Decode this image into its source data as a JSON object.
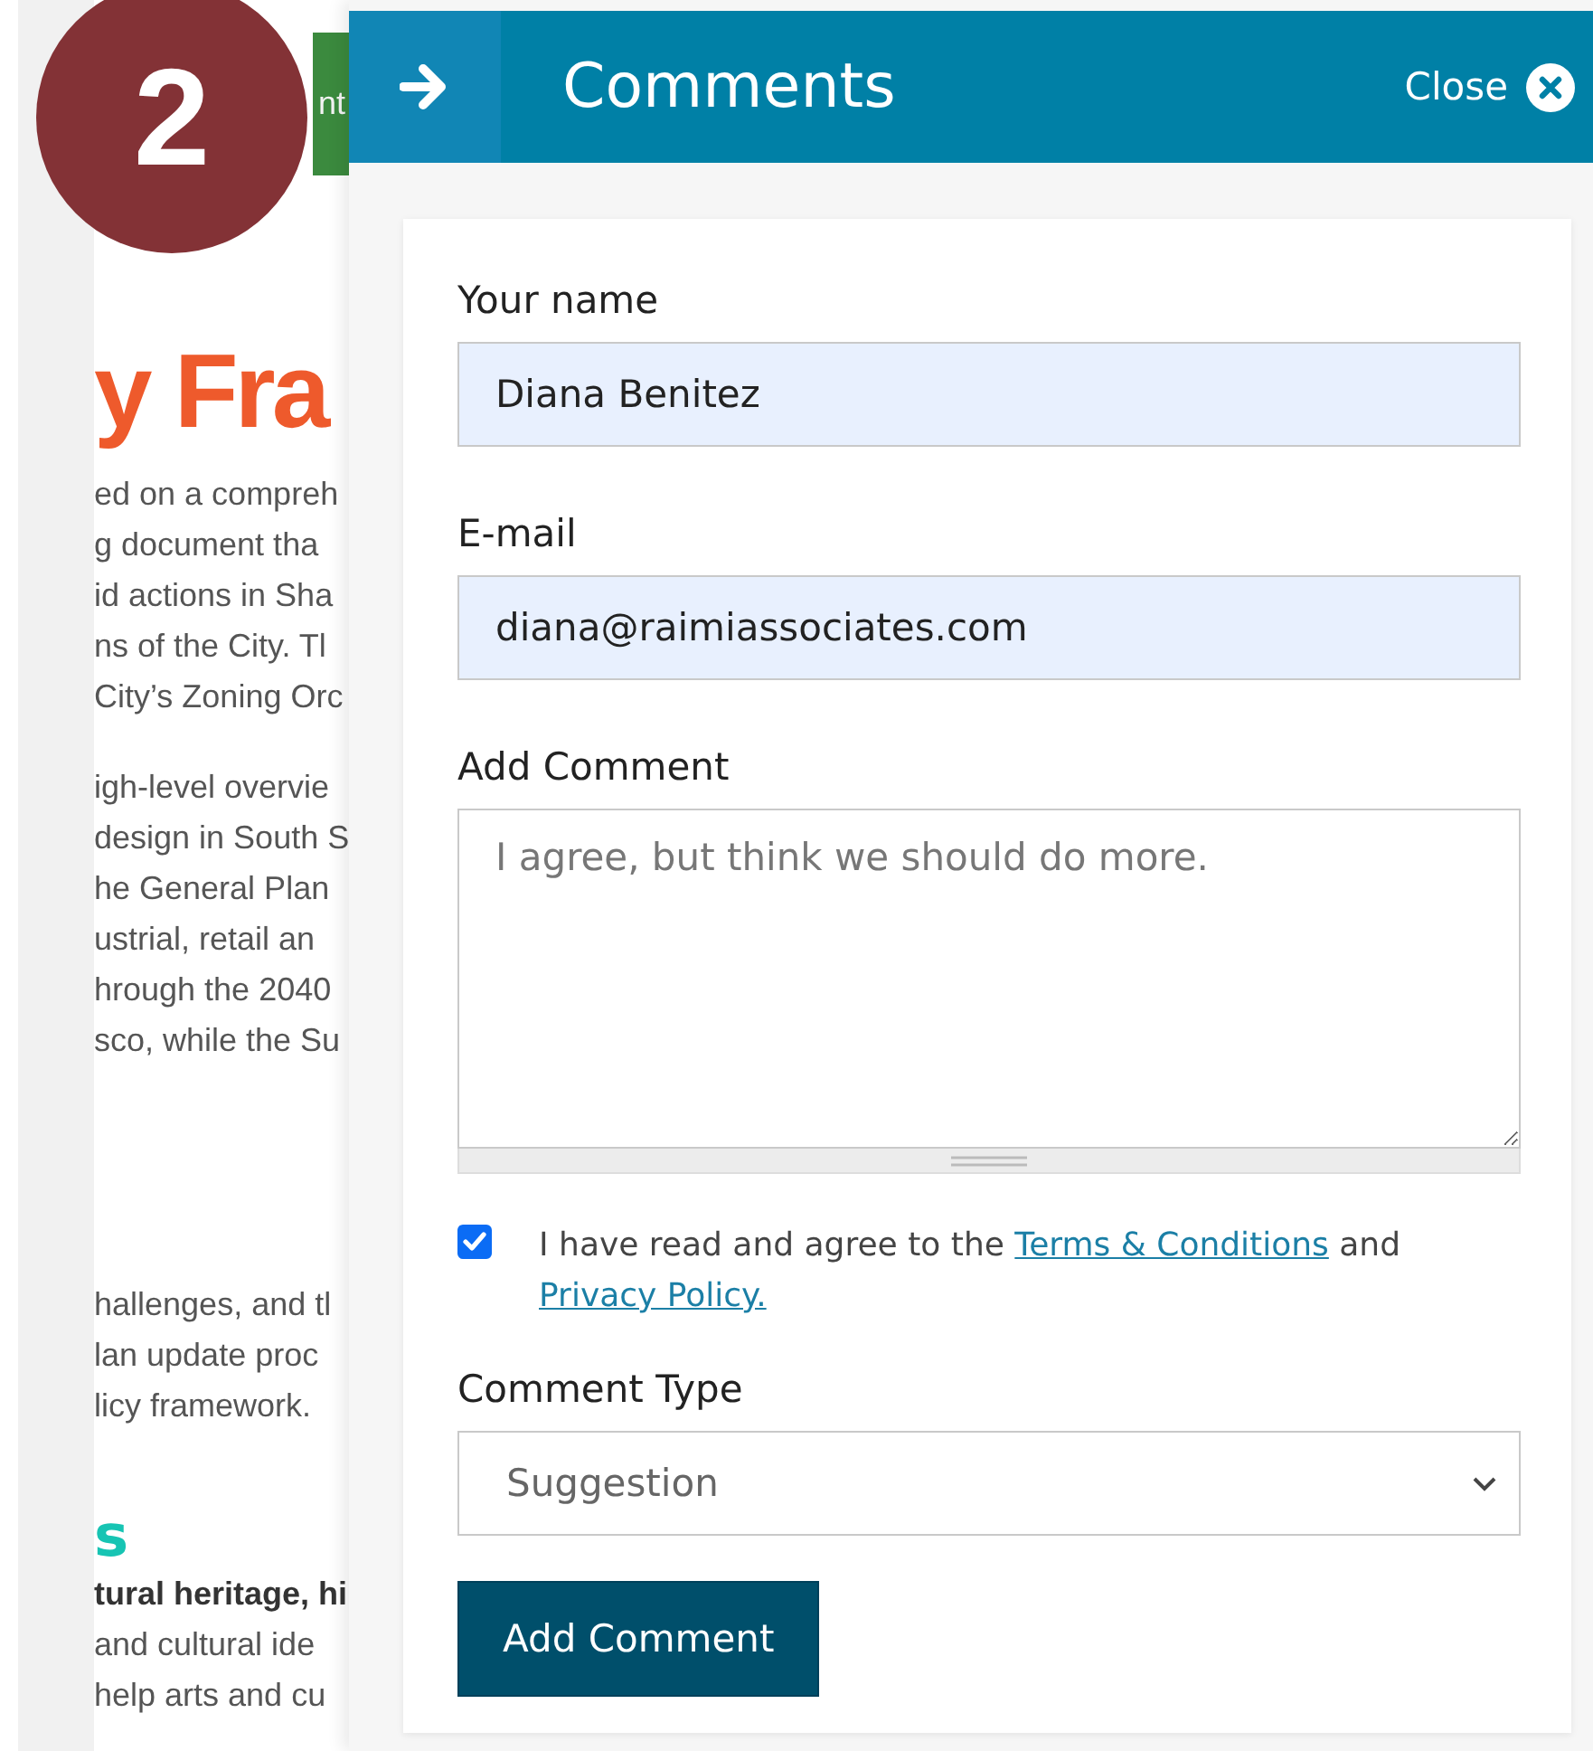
{
  "background_page": {
    "button_text": "nt",
    "heading": "y Fra",
    "paragraphs": [
      [
        "ed on a compreh",
        "g document tha",
        "id actions in Sha",
        "ns of the City. Tl",
        "City’s Zoning Orc"
      ],
      [
        "igh-level overvie",
        "design in South S",
        "he General Plan",
        "ustrial, retail an",
        "hrough the 2040",
        "sco, while the Su"
      ],
      [
        "hallenges, and tl",
        "lan update proc",
        "licy framework."
      ]
    ],
    "subheading": "s",
    "bold_line": "tural heritage, hi",
    "lines_after": [
      "and cultural ide",
      "help arts and cu"
    ]
  },
  "step_badge": "2",
  "panel": {
    "title": "Comments",
    "close_label": "Close"
  },
  "form": {
    "name": {
      "label": "Your name",
      "value": "Diana Benitez"
    },
    "email": {
      "label": "E-mail",
      "value": "diana@raimiassociates.com"
    },
    "comment": {
      "label": "Add Comment",
      "placeholder": "I agree, but think we should do more."
    },
    "agreement": {
      "checked": true,
      "text_before": "I have read and agree to the ",
      "terms_link": "Terms & Conditions",
      "text_between": " and ",
      "privacy_link": "Privacy Policy."
    },
    "comment_type": {
      "label": "Comment Type",
      "value": "Suggestion"
    },
    "submit": "Add Comment"
  }
}
